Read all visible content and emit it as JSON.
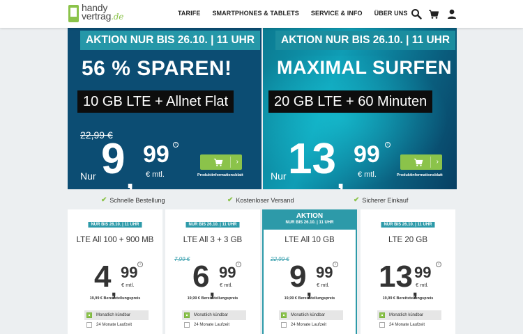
{
  "header": {
    "logo_line1": "handy",
    "logo_line2": "vertrag",
    "logo_suffix": ".de",
    "nav": [
      "TARIFE",
      "SMARTPHONES & TABLETS",
      "SERVICE & INFO",
      "ÜBER UNS"
    ],
    "icons": [
      "search-icon",
      "cart-icon",
      "user-icon"
    ]
  },
  "banners": [
    {
      "tag": "AKTION NUR BIS 26.10. | 11 UHR",
      "headline": "56 % SPAREN!",
      "box": "10 GB LTE + Allnet Flat",
      "old_price": "22,99 €",
      "prefix": "Nur",
      "price_int": "9",
      "price_dec": "99",
      "unit": "€ mtl.",
      "info": "i",
      "link": "Produktinformationsblatt",
      "chevron": "›"
    },
    {
      "tag": "AKTION NUR BIS 26.10. | 11 UHR",
      "headline": "MAXIMAL SURFEN",
      "box": "20 GB LTE + 60 Minuten",
      "old_price": "",
      "prefix": "Nur",
      "price_int": "13",
      "price_dec": "99",
      "unit": "€ mtl.",
      "info": "i",
      "link": "Produktinformationsblatt",
      "chevron": "›"
    }
  ],
  "trust": [
    "Schnelle Bestellung",
    "Kostenloser Versand",
    "Sicherer Einkauf"
  ],
  "trust_check": "✔",
  "cards": [
    {
      "badge": "NUR BIS 26.10. | 11 UHR",
      "name": "LTE All 100 + 900 MB",
      "old": "",
      "int": "4",
      "dec": "99",
      "unit": "€ mtl.",
      "fee": "19,99 € Bereitstellungspreis",
      "options": [
        "Monatlich kündbar",
        "24 Monate Laufzeit"
      ]
    },
    {
      "badge": "NUR BIS 26.10. | 11 UHR",
      "name": "LTE All 3 + 3 GB",
      "old": "7,99 €",
      "int": "6",
      "dec": "99",
      "unit": "€ mtl.",
      "fee": "19,99 € Bereitstellungspreis",
      "options": [
        "Monatlich kündbar",
        "24 Monate Laufzeit"
      ]
    },
    {
      "top_label": "AKTION",
      "badge": "NUR BIS 26.10. | 11 UHR",
      "name": "LTE All 10 GB",
      "old": "22,99 €",
      "int": "9",
      "dec": "99",
      "unit": "€ mtl.",
      "fee": "19,99 € Bereitstellungspreis",
      "options": [
        "Monatlich kündbar",
        "24 Monate Laufzeit"
      ]
    },
    {
      "badge": "NUR BIS 26.10. | 11 UHR",
      "name": "LTE 20 GB",
      "old": "",
      "int": "13",
      "dec": "99",
      "unit": "€ mtl.",
      "fee": "19,99 € Bereitstellungspreis",
      "options": [
        "Monatlich kündbar",
        "24 Monate Laufzeit"
      ]
    }
  ],
  "colors": {
    "brand_green": "#8bc34a",
    "teal": "#2d9aa9",
    "banner_dark": "#0c4d73"
  },
  "comma": ","
}
